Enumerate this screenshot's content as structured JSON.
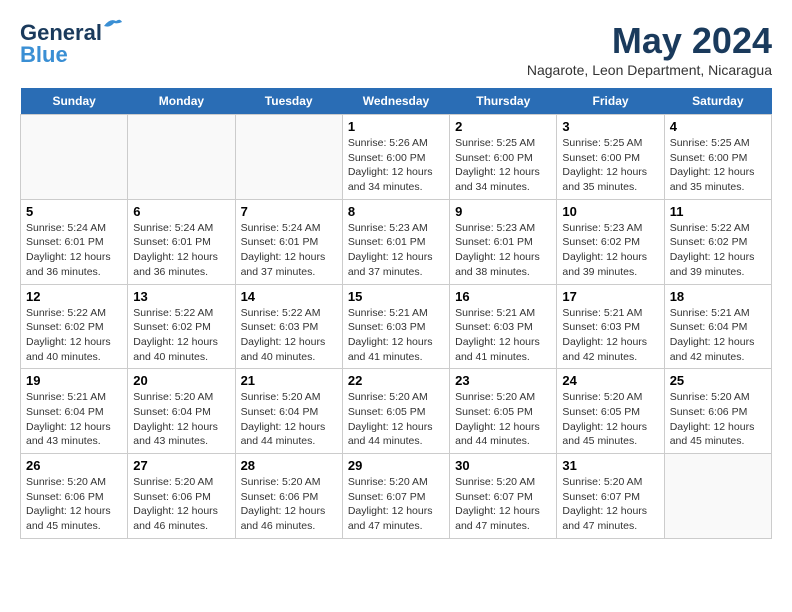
{
  "header": {
    "logo_general": "General",
    "logo_blue": "Blue",
    "title": "May 2024",
    "subtitle": "Nagarote, Leon Department, Nicaragua"
  },
  "days_of_week": [
    "Sunday",
    "Monday",
    "Tuesday",
    "Wednesday",
    "Thursday",
    "Friday",
    "Saturday"
  ],
  "weeks": [
    [
      {
        "num": "",
        "info": ""
      },
      {
        "num": "",
        "info": ""
      },
      {
        "num": "",
        "info": ""
      },
      {
        "num": "1",
        "info": "Sunrise: 5:26 AM\nSunset: 6:00 PM\nDaylight: 12 hours\nand 34 minutes."
      },
      {
        "num": "2",
        "info": "Sunrise: 5:25 AM\nSunset: 6:00 PM\nDaylight: 12 hours\nand 34 minutes."
      },
      {
        "num": "3",
        "info": "Sunrise: 5:25 AM\nSunset: 6:00 PM\nDaylight: 12 hours\nand 35 minutes."
      },
      {
        "num": "4",
        "info": "Sunrise: 5:25 AM\nSunset: 6:00 PM\nDaylight: 12 hours\nand 35 minutes."
      }
    ],
    [
      {
        "num": "5",
        "info": "Sunrise: 5:24 AM\nSunset: 6:01 PM\nDaylight: 12 hours\nand 36 minutes."
      },
      {
        "num": "6",
        "info": "Sunrise: 5:24 AM\nSunset: 6:01 PM\nDaylight: 12 hours\nand 36 minutes."
      },
      {
        "num": "7",
        "info": "Sunrise: 5:24 AM\nSunset: 6:01 PM\nDaylight: 12 hours\nand 37 minutes."
      },
      {
        "num": "8",
        "info": "Sunrise: 5:23 AM\nSunset: 6:01 PM\nDaylight: 12 hours\nand 37 minutes."
      },
      {
        "num": "9",
        "info": "Sunrise: 5:23 AM\nSunset: 6:01 PM\nDaylight: 12 hours\nand 38 minutes."
      },
      {
        "num": "10",
        "info": "Sunrise: 5:23 AM\nSunset: 6:02 PM\nDaylight: 12 hours\nand 39 minutes."
      },
      {
        "num": "11",
        "info": "Sunrise: 5:22 AM\nSunset: 6:02 PM\nDaylight: 12 hours\nand 39 minutes."
      }
    ],
    [
      {
        "num": "12",
        "info": "Sunrise: 5:22 AM\nSunset: 6:02 PM\nDaylight: 12 hours\nand 40 minutes."
      },
      {
        "num": "13",
        "info": "Sunrise: 5:22 AM\nSunset: 6:02 PM\nDaylight: 12 hours\nand 40 minutes."
      },
      {
        "num": "14",
        "info": "Sunrise: 5:22 AM\nSunset: 6:03 PM\nDaylight: 12 hours\nand 40 minutes."
      },
      {
        "num": "15",
        "info": "Sunrise: 5:21 AM\nSunset: 6:03 PM\nDaylight: 12 hours\nand 41 minutes."
      },
      {
        "num": "16",
        "info": "Sunrise: 5:21 AM\nSunset: 6:03 PM\nDaylight: 12 hours\nand 41 minutes."
      },
      {
        "num": "17",
        "info": "Sunrise: 5:21 AM\nSunset: 6:03 PM\nDaylight: 12 hours\nand 42 minutes."
      },
      {
        "num": "18",
        "info": "Sunrise: 5:21 AM\nSunset: 6:04 PM\nDaylight: 12 hours\nand 42 minutes."
      }
    ],
    [
      {
        "num": "19",
        "info": "Sunrise: 5:21 AM\nSunset: 6:04 PM\nDaylight: 12 hours\nand 43 minutes."
      },
      {
        "num": "20",
        "info": "Sunrise: 5:20 AM\nSunset: 6:04 PM\nDaylight: 12 hours\nand 43 minutes."
      },
      {
        "num": "21",
        "info": "Sunrise: 5:20 AM\nSunset: 6:04 PM\nDaylight: 12 hours\nand 44 minutes."
      },
      {
        "num": "22",
        "info": "Sunrise: 5:20 AM\nSunset: 6:05 PM\nDaylight: 12 hours\nand 44 minutes."
      },
      {
        "num": "23",
        "info": "Sunrise: 5:20 AM\nSunset: 6:05 PM\nDaylight: 12 hours\nand 44 minutes."
      },
      {
        "num": "24",
        "info": "Sunrise: 5:20 AM\nSunset: 6:05 PM\nDaylight: 12 hours\nand 45 minutes."
      },
      {
        "num": "25",
        "info": "Sunrise: 5:20 AM\nSunset: 6:06 PM\nDaylight: 12 hours\nand 45 minutes."
      }
    ],
    [
      {
        "num": "26",
        "info": "Sunrise: 5:20 AM\nSunset: 6:06 PM\nDaylight: 12 hours\nand 45 minutes."
      },
      {
        "num": "27",
        "info": "Sunrise: 5:20 AM\nSunset: 6:06 PM\nDaylight: 12 hours\nand 46 minutes."
      },
      {
        "num": "28",
        "info": "Sunrise: 5:20 AM\nSunset: 6:06 PM\nDaylight: 12 hours\nand 46 minutes."
      },
      {
        "num": "29",
        "info": "Sunrise: 5:20 AM\nSunset: 6:07 PM\nDaylight: 12 hours\nand 47 minutes."
      },
      {
        "num": "30",
        "info": "Sunrise: 5:20 AM\nSunset: 6:07 PM\nDaylight: 12 hours\nand 47 minutes."
      },
      {
        "num": "31",
        "info": "Sunrise: 5:20 AM\nSunset: 6:07 PM\nDaylight: 12 hours\nand 47 minutes."
      },
      {
        "num": "",
        "info": ""
      }
    ]
  ]
}
